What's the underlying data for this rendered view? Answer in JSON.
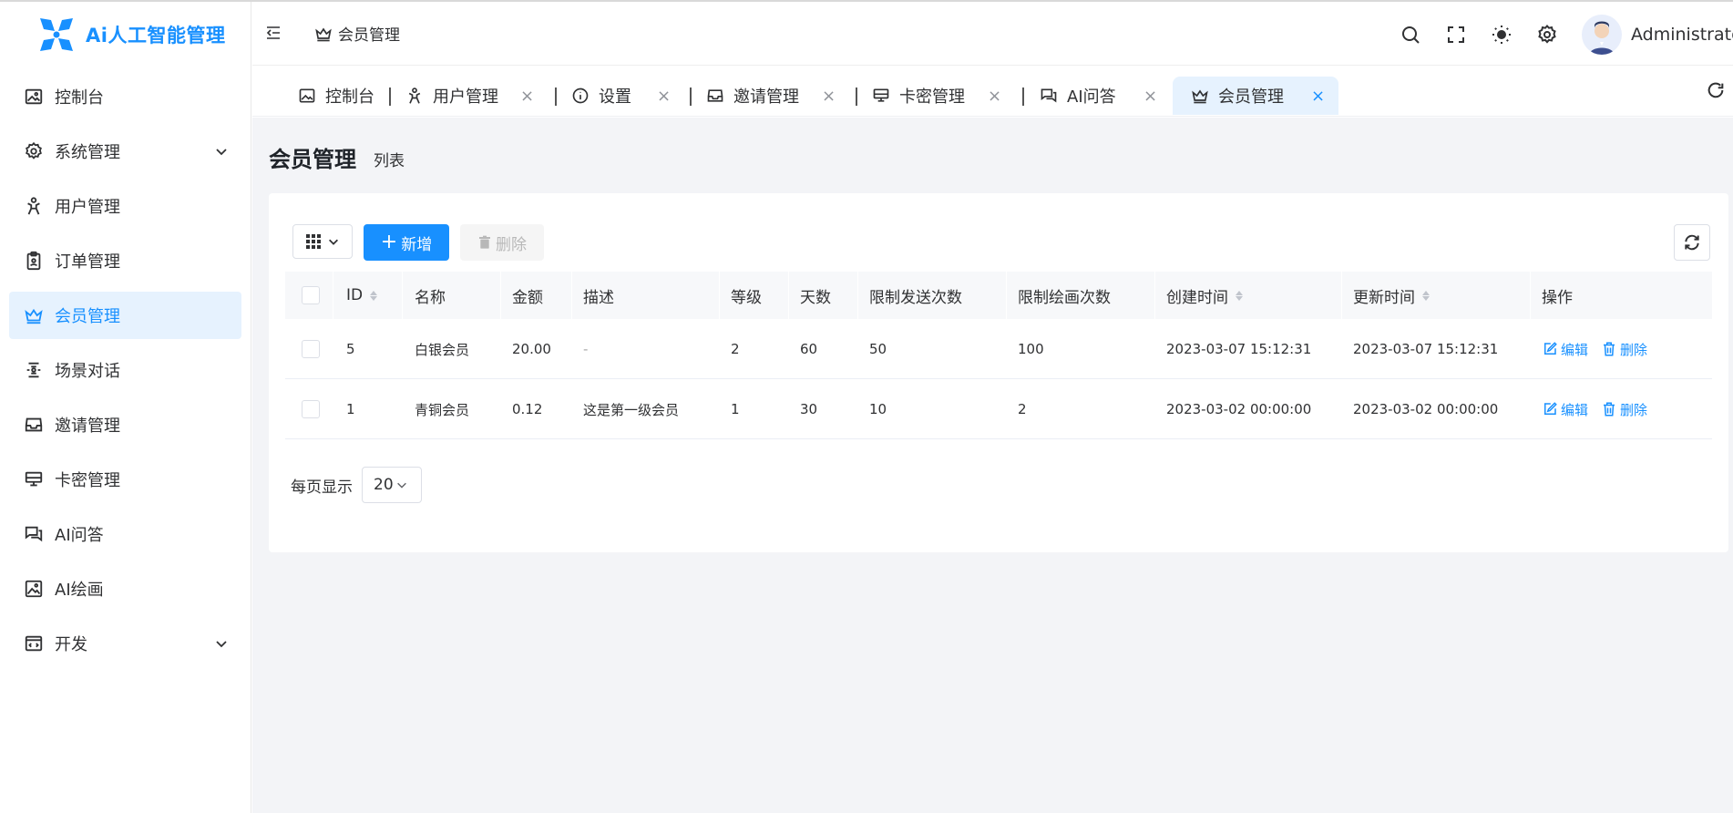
{
  "app": {
    "logo_text": "Ai人工智能管理"
  },
  "sidebar": {
    "items": [
      {
        "label": "控制台",
        "icon": "image-icon"
      },
      {
        "label": "系统管理",
        "icon": "gear-icon"
      },
      {
        "label": "用户管理",
        "icon": "user-icon"
      },
      {
        "label": "订单管理",
        "icon": "clipboard-icon"
      },
      {
        "label": "会员管理",
        "icon": "crown-icon"
      },
      {
        "label": "场景对话",
        "icon": "scene-icon"
      },
      {
        "label": "邀请管理",
        "icon": "inbox-icon"
      },
      {
        "label": "卡密管理",
        "icon": "monitor-icon"
      },
      {
        "label": "AI问答",
        "icon": "chat-icon"
      },
      {
        "label": "AI绘画",
        "icon": "picture-icon"
      },
      {
        "label": "开发",
        "icon": "dev-icon"
      }
    ],
    "active_index": 4
  },
  "header": {
    "breadcrumb": "会员管理",
    "username": "Administrator"
  },
  "tabs": [
    {
      "label": "控制台"
    },
    {
      "label": "用户管理"
    },
    {
      "label": "设置"
    },
    {
      "label": "邀请管理"
    },
    {
      "label": "卡密管理"
    },
    {
      "label": "AI问答"
    },
    {
      "label": "会员管理"
    }
  ],
  "page": {
    "title": "会员管理",
    "subtitle": "列表"
  },
  "toolbar": {
    "add_label": "新增",
    "delete_label": "删除"
  },
  "table": {
    "headers": {
      "id": "ID",
      "name": "名称",
      "amount": "金额",
      "desc": "描述",
      "level": "等级",
      "days": "天数",
      "send_limit": "限制发送次数",
      "draw_limit": "限制绘画次数",
      "created": "创建时间",
      "updated": "更新时间",
      "actions": "操作"
    },
    "rows": [
      {
        "id": "5",
        "name": "白银会员",
        "amount": "20.00",
        "desc": "-",
        "level": "2",
        "days": "60",
        "send_limit": "50",
        "draw_limit": "100",
        "created": "2023-03-07 15:12:31",
        "updated": "2023-03-07 15:12:31"
      },
      {
        "id": "1",
        "name": "青铜会员",
        "amount": "0.12",
        "desc": "这是第一级会员",
        "level": "1",
        "days": "30",
        "send_limit": "10",
        "draw_limit": "2",
        "created": "2023-03-02 00:00:00",
        "updated": "2023-03-02 00:00:00"
      }
    ],
    "edit_label": "编辑",
    "delete_label": "删除"
  },
  "pager": {
    "label": "每页显示",
    "page_size": "20"
  },
  "colors": {
    "accent": "#1890ff",
    "active_bg": "#e6f2fe",
    "content_bg": "#f3f4f7"
  }
}
